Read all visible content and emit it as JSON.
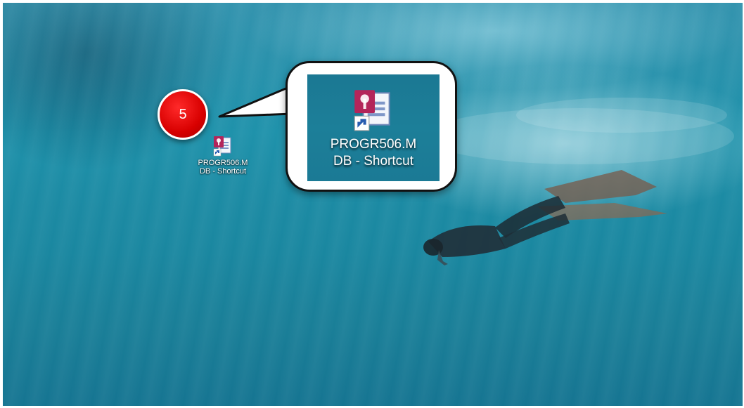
{
  "desktop": {
    "wallpaper": "underwater diver",
    "icons": [
      {
        "name": "PROGR506.MDB - Shortcut",
        "label_line1": "PROGR506.M",
        "label_line2": "DB - Shortcut",
        "icon": "access-database-shortcut-icon"
      }
    ]
  },
  "callout": {
    "step_number": "5",
    "label_line1": "PROGR506.M",
    "label_line2": "DB - Shortcut",
    "badge_color": "#d80000"
  }
}
